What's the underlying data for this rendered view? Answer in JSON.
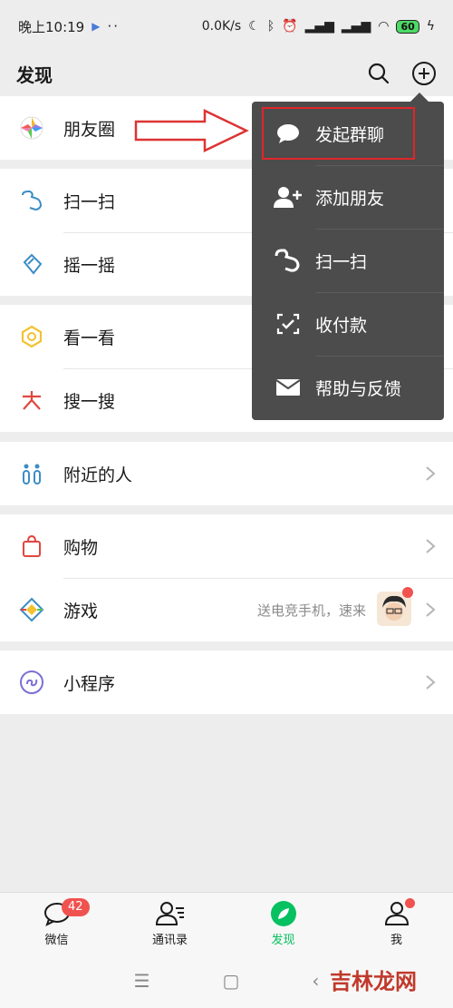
{
  "status": {
    "time": "晚上10:19",
    "network_speed": "0.0K/s",
    "battery": "60"
  },
  "header": {
    "title": "发现"
  },
  "groups": [
    {
      "items": [
        {
          "label": "朋友圈",
          "icon": "moments-icon"
        }
      ]
    },
    {
      "items": [
        {
          "label": "扫一扫",
          "icon": "scan-icon"
        },
        {
          "label": "摇一摇",
          "icon": "shake-icon"
        }
      ]
    },
    {
      "items": [
        {
          "label": "看一看",
          "icon": "top-stories-icon"
        },
        {
          "label": "搜一搜",
          "icon": "search-feature-icon"
        }
      ]
    },
    {
      "items": [
        {
          "label": "附近的人",
          "icon": "people-nearby-icon"
        }
      ]
    },
    {
      "items": [
        {
          "label": "购物",
          "icon": "shopping-bag-icon"
        },
        {
          "label": "游戏",
          "icon": "games-icon",
          "subtitle": "送电竞手机，速来"
        }
      ]
    },
    {
      "items": [
        {
          "label": "小程序",
          "icon": "mini-programs-icon"
        }
      ]
    }
  ],
  "popup_menu": {
    "items": [
      {
        "label": "发起群聊",
        "icon": "chat-bubble-icon"
      },
      {
        "label": "添加朋友",
        "icon": "add-friend-icon"
      },
      {
        "label": "扫一扫",
        "icon": "scan-icon"
      },
      {
        "label": "收付款",
        "icon": "payment-icon"
      },
      {
        "label": "帮助与反馈",
        "icon": "mail-icon"
      }
    ]
  },
  "bottom_nav": {
    "items": [
      {
        "label": "微信",
        "badge": "42"
      },
      {
        "label": "通讯录"
      },
      {
        "label": "发现"
      },
      {
        "label": "我"
      }
    ]
  },
  "watermark": "吉林龙网",
  "colors": {
    "accent": "#07c160",
    "badge": "#f0524f",
    "popup_bg": "#4c4c4c",
    "highlight": "#e0262b"
  }
}
